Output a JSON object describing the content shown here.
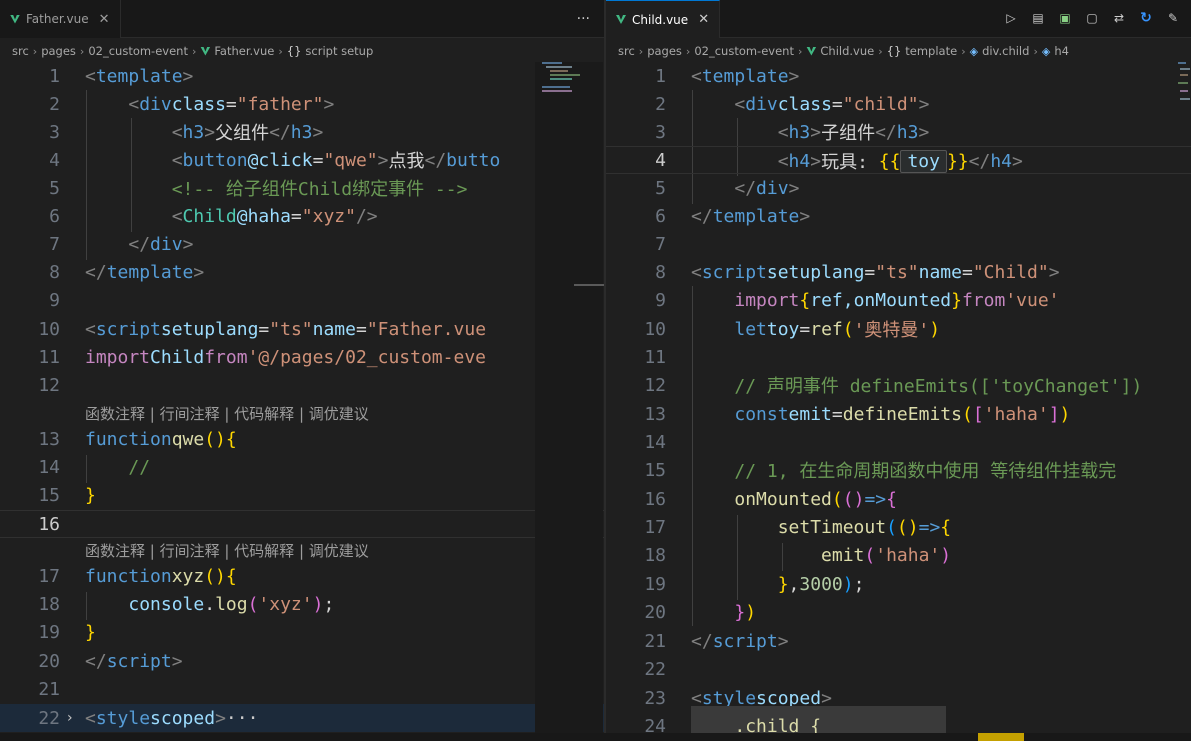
{
  "left": {
    "tab": {
      "label": "Father.vue",
      "close": "✕"
    },
    "more": "···",
    "breadcrumb": [
      "src",
      "pages",
      "02_custom-event",
      "Father.vue",
      "script setup"
    ],
    "codelens1": "函数注释 | 行间注释 | 代码解释 | 调优建议",
    "codelens2": "函数注释 | 行间注释 | 代码解释 | 调优建议",
    "lines": [
      {
        "n": "1"
      },
      {
        "n": "2"
      },
      {
        "n": "3"
      },
      {
        "n": "4"
      },
      {
        "n": "5"
      },
      {
        "n": "6"
      },
      {
        "n": "7"
      },
      {
        "n": "8"
      },
      {
        "n": "9"
      },
      {
        "n": "10"
      },
      {
        "n": "11"
      },
      {
        "n": "12"
      },
      {
        "n": "13"
      },
      {
        "n": "14"
      },
      {
        "n": "15"
      },
      {
        "n": "16"
      },
      {
        "n": "17"
      },
      {
        "n": "18"
      },
      {
        "n": "19"
      },
      {
        "n": "20"
      },
      {
        "n": "21"
      },
      {
        "n": "22"
      }
    ],
    "text": {
      "l1_tag": "template",
      "l2_tag": "div",
      "l2_attr": "class",
      "l2_val": "\"father\"",
      "l3_tag": "h3",
      "l3_text": "父组件",
      "l3_close": "h3",
      "l4_tag": "button",
      "l4_attr": "@click",
      "l4_val": "\"qwe\"",
      "l4_text": "点我",
      "l4_close": "butto",
      "l5_comment": "<!-- 给子组件Child绑定事件 -->",
      "l6_comp": "Child",
      "l6_attr": "@haha",
      "l6_val": "\"xyz\"",
      "l7_tag": "div",
      "l8_tag": "template",
      "l10_tag": "script",
      "l10_a1": "setup",
      "l10_a2": "lang",
      "l10_v2": "\"ts\"",
      "l10_a3": "name",
      "l10_v3": "\"Father.vue",
      "l11_kw": "import",
      "l11_comp": "Child",
      "l11_from": "from",
      "l11_str": "'@/pages/02_custom-eve",
      "l13_kw": "function",
      "l13_fn": "qwe",
      "l14_comment": "//",
      "l17_kw": "function",
      "l17_fn": "xyz",
      "l18_obj": "console",
      "l18_fn": "log",
      "l18_str": "'xyz'",
      "l20_tag": "script",
      "l22_tag": "style",
      "l22_attr": "scoped",
      "l22_more": "···"
    }
  },
  "right": {
    "tab": {
      "label": "Child.vue",
      "close": "✕"
    },
    "breadcrumb": [
      "src",
      "pages",
      "02_custom-event",
      "Child.vue",
      "template",
      "div.child",
      "h4"
    ],
    "lines": [
      {
        "n": "1"
      },
      {
        "n": "2"
      },
      {
        "n": "3"
      },
      {
        "n": "4"
      },
      {
        "n": "5"
      },
      {
        "n": "6"
      },
      {
        "n": "7"
      },
      {
        "n": "8"
      },
      {
        "n": "9"
      },
      {
        "n": "10"
      },
      {
        "n": "11"
      },
      {
        "n": "12"
      },
      {
        "n": "13"
      },
      {
        "n": "14"
      },
      {
        "n": "15"
      },
      {
        "n": "16"
      },
      {
        "n": "17"
      },
      {
        "n": "18"
      },
      {
        "n": "19"
      },
      {
        "n": "20"
      },
      {
        "n": "21"
      },
      {
        "n": "22"
      },
      {
        "n": "23"
      },
      {
        "n": "24"
      }
    ],
    "text": {
      "l1_tag": "template",
      "l2_tag": "div",
      "l2_attr": "class",
      "l2_val": "\"child\"",
      "l3_tag": "h3",
      "l3_text": "子组件",
      "l3_close": "h3",
      "l4_tag": "h4",
      "l4_text": "玩具: ",
      "l4_var": "toy",
      "l4_close": "h4",
      "l5_tag": "div",
      "l6_tag": "template",
      "l8_tag": "script",
      "l8_a1": "setup",
      "l8_a2": "lang",
      "l8_v2": "\"ts\"",
      "l8_a3": "name",
      "l8_v3": "\"Child\"",
      "l9_kw": "import",
      "l9_names": "ref,onMounted",
      "l9_from": "from",
      "l9_str": "'vue'",
      "l10_kw": "let",
      "l10_var": "toy",
      "l10_fn": "ref",
      "l10_str": "'奥特曼'",
      "l12_comment": "// 声明事件 defineEmits(['toyChanget'])",
      "l13_kw": "const",
      "l13_var": "emit",
      "l13_fn": "defineEmits",
      "l13_str": "'haha'",
      "l15_comment": "// 1, 在生命周期函数中使用 等待组件挂载完",
      "l16_fn": "onMounted",
      "l17_fn": "setTimeout",
      "l18_fn": "emit",
      "l18_str": "'haha'",
      "l19_num": "3000",
      "l21_tag": "script",
      "l23_tag": "style",
      "l23_attr": "scoped",
      "l24_sel": ".child {"
    }
  }
}
